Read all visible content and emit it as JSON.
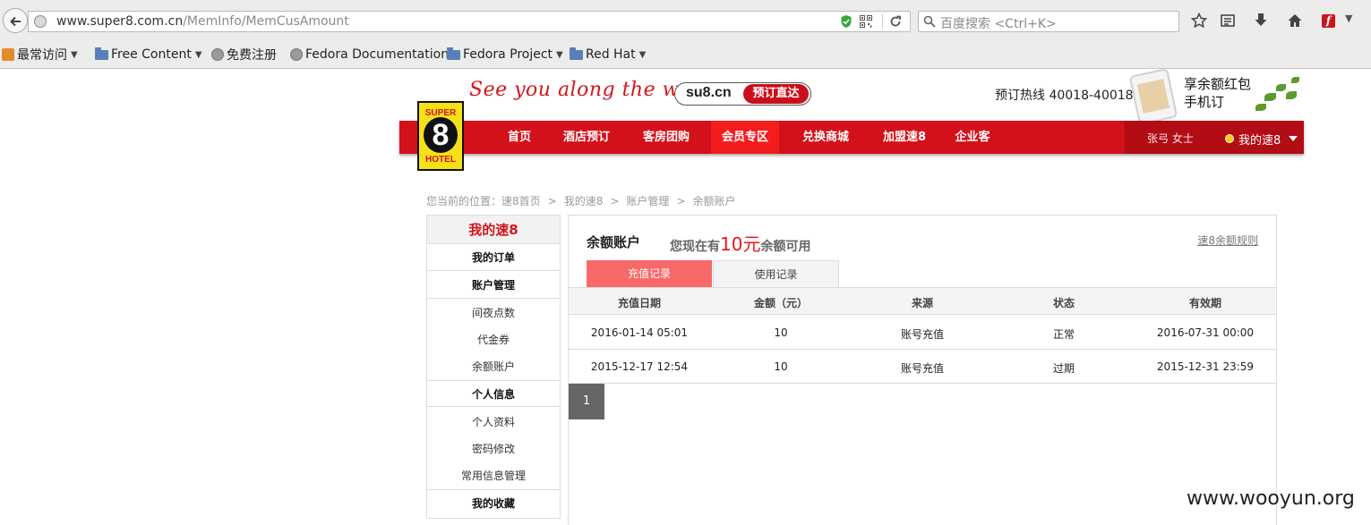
{
  "browser": {
    "url_host": "www.super8.com.cn",
    "url_path": "/MemInfo/MemCusAmount",
    "search_placeholder": "百度搜索 <Ctrl+K>",
    "bookmarks": [
      {
        "label": "最常访问",
        "dropdown": true,
        "icon": "most-visited-icon"
      },
      {
        "label": "Free Content",
        "dropdown": true,
        "icon": "folder-icon"
      },
      {
        "label": "免费注册",
        "dropdown": false,
        "icon": "globe-icon"
      },
      {
        "label": "Fedora Documentation",
        "dropdown": false,
        "icon": "globe-icon"
      },
      {
        "label": "Fedora Project",
        "dropdown": true,
        "icon": "folder-icon"
      },
      {
        "label": "Red Hat",
        "dropdown": true,
        "icon": "folder-icon"
      }
    ]
  },
  "header": {
    "slogan": "See you along the way",
    "domain": "su8.cn",
    "domain_cta": "预订直达",
    "hotline": "预订热线 40018-40018",
    "ad_line1": "享余额红包",
    "ad_line2": "手机订"
  },
  "logo": {
    "top": "SUPER",
    "digit": "8",
    "bottom": "HOTEL"
  },
  "nav": {
    "items": [
      "首页",
      "酒店预订",
      "客房团购",
      "会员专区",
      "兑换商城",
      "加盟速8",
      "企业客"
    ],
    "active_index": 3,
    "user_name": "张弓 女士",
    "my_menu": "我的速8"
  },
  "breadcrumb": {
    "prefix": "您当前的位置：",
    "items": [
      "速8首页",
      "我的速8",
      "账户管理",
      "余额账户"
    ],
    "separator": ">"
  },
  "sidebar": {
    "title": "我的速8",
    "rows": [
      {
        "label": "我的订单",
        "header": true
      },
      {
        "label": "账户管理",
        "header": true
      },
      {
        "label": "间夜点数",
        "header": false
      },
      {
        "label": "代金券",
        "header": false
      },
      {
        "label": "余额账户",
        "header": false
      },
      {
        "label": "个人信息",
        "header": true
      },
      {
        "label": "个人资料",
        "header": false
      },
      {
        "label": "密码修改",
        "header": false
      },
      {
        "label": "常用信息管理",
        "header": false
      },
      {
        "label": "我的收藏",
        "header": true
      }
    ]
  },
  "main": {
    "title": "余额账户",
    "balance_prefix": "您现在有",
    "balance_amount": "10元",
    "balance_suffix": "余额可用",
    "rules_link": "速8余额规则",
    "tabs": [
      "充值记录",
      "使用记录"
    ],
    "columns": [
      "充值日期",
      "金额（元）",
      "来源",
      "状态",
      "有效期"
    ],
    "rows": [
      [
        "2016-01-14 05:01",
        "10",
        "账号充值",
        "正常",
        "2016-07-31 00:00"
      ],
      [
        "2015-12-17 12:54",
        "10",
        "账号充值",
        "过期",
        "2015-12-31 23:59"
      ]
    ],
    "page": "1"
  },
  "watermark": "www.wooyun.org",
  "colors": {
    "brand_red": "#d3111b",
    "active_nav": "#f41d1d",
    "tab_active": "#f8696a",
    "logo_yellow": "#f5e11a"
  }
}
